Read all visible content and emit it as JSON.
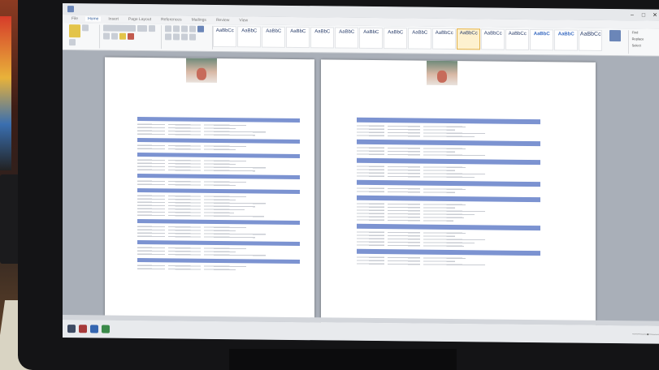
{
  "window": {
    "title": "",
    "tabs": [
      "File",
      "Home",
      "Insert",
      "Page Layout",
      "References",
      "Mailings",
      "Review",
      "View"
    ],
    "active_tab": 1
  },
  "ribbon": {
    "styles": [
      {
        "sample": "AaBbCc",
        "name": "",
        "cls": ""
      },
      {
        "sample": "AaBbC",
        "name": "",
        "cls": ""
      },
      {
        "sample": "AaBbC",
        "name": "",
        "cls": ""
      },
      {
        "sample": "AaBbC",
        "name": "",
        "cls": ""
      },
      {
        "sample": "AaBbC",
        "name": "",
        "cls": ""
      },
      {
        "sample": "AaBbC",
        "name": "",
        "cls": ""
      },
      {
        "sample": "AaBbC",
        "name": "",
        "cls": ""
      },
      {
        "sample": "AaBbC",
        "name": "",
        "cls": ""
      },
      {
        "sample": "AaBbC",
        "name": "",
        "cls": ""
      },
      {
        "sample": "AaBbCc",
        "name": "",
        "cls": ""
      },
      {
        "sample": "AaBbCc",
        "name": "",
        "cls": "active"
      },
      {
        "sample": "AaBbCc",
        "name": "",
        "cls": ""
      },
      {
        "sample": "AaBbCc",
        "name": "",
        "cls": ""
      },
      {
        "sample": "AaBbC",
        "name": "",
        "cls": "h"
      },
      {
        "sample": "AaBbC",
        "name": "",
        "cls": "h"
      },
      {
        "sample": "AaBbCc",
        "name": "",
        "cls": "title"
      }
    ],
    "change_styles_label": "",
    "editing": [
      "Find",
      "Replace",
      "Select"
    ]
  },
  "document": {
    "page1": {
      "header_lines": [
        "",
        "",
        "",
        ""
      ],
      "sections": [
        {
          "rows": 4
        },
        {
          "rows": 2
        },
        {
          "rows": 4
        },
        {
          "rows": 2
        },
        {
          "rows": 7
        },
        {
          "rows": 4
        },
        {
          "rows": 3
        },
        {
          "rows": 2
        }
      ]
    },
    "page2": {
      "header_name": "",
      "header_lines": [
        "",
        ""
      ],
      "sections": [
        {
          "rows": 4
        },
        {
          "rows": 3
        },
        {
          "rows": 4
        },
        {
          "rows": 2
        },
        {
          "rows": 6
        },
        {
          "rows": 5
        },
        {
          "rows": 3
        }
      ]
    }
  },
  "status": {
    "left": "",
    "right": ""
  }
}
